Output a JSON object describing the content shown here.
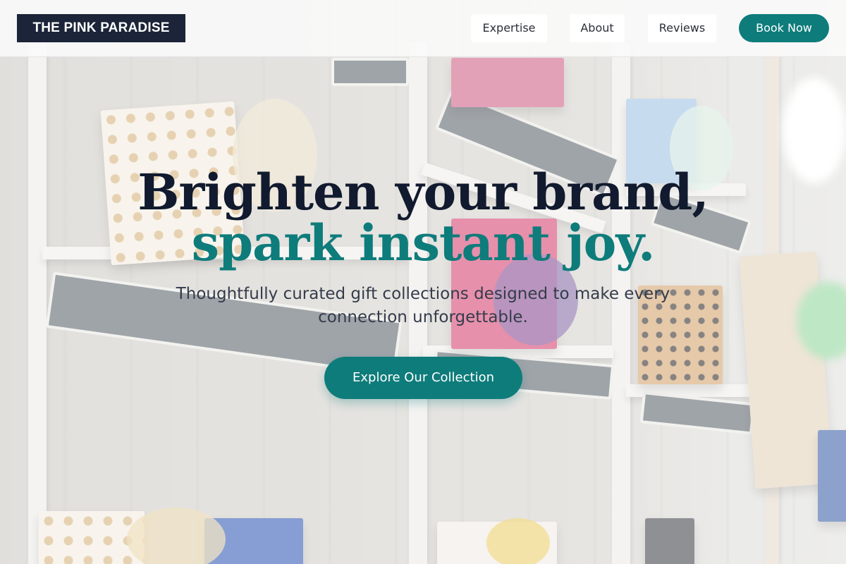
{
  "brand": {
    "logo_text": "THE PINK PARADISE"
  },
  "nav": {
    "links": [
      {
        "label": "Expertise"
      },
      {
        "label": "About"
      },
      {
        "label": "Reviews"
      }
    ],
    "cta_label": "Book Now"
  },
  "hero": {
    "headline_line1": "Brighten your brand,",
    "headline_line2": "spark instant joy.",
    "tagline": "Thoughtfully curated gift collections designed to make every connection unforgettable.",
    "cta_label": "Explore Our Collection"
  },
  "colors": {
    "brand_dark": "#1b2438",
    "accent_teal": "#0e7c7b",
    "headline_dark": "#111a2e",
    "background_overlay": "#ffffff"
  },
  "background_image": {
    "subject": "gift-boxes-on-shelves"
  }
}
